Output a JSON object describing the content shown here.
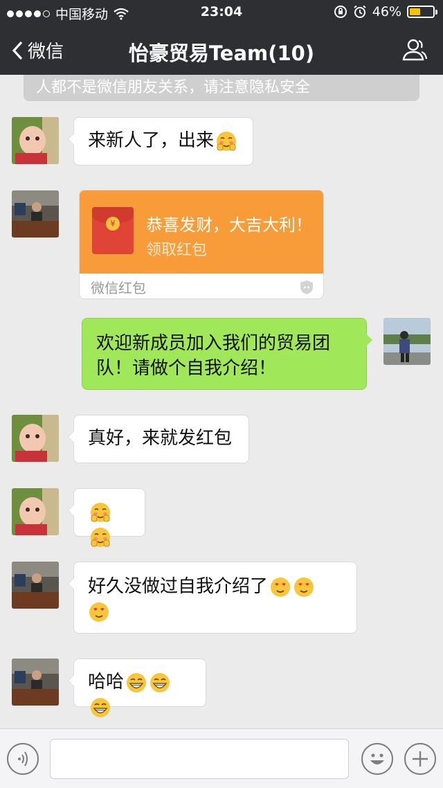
{
  "status": {
    "carrier": "中国移动",
    "time": "23:04",
    "battery": "46%",
    "battery_level": 0.46
  },
  "nav": {
    "back_label": "微信",
    "title": "怡豪贸易Team(10)"
  },
  "notice": "人都不是微信朋友关系，请注意隐私安全",
  "messages": [
    {
      "text": "来新人了，出来"
    },
    {
      "packet_title": "恭喜发财，大吉大利！",
      "packet_action": "领取红包",
      "packet_footer": "微信红包",
      "coin": "¥"
    },
    {
      "text_line1": "欢迎新成员加入我们的贸易团",
      "text_line2": "队！请做个自我介绍！"
    },
    {
      "text": "真好，来就发红包"
    },
    {
      "text": ""
    },
    {
      "text": "好久没做过自我介绍了"
    },
    {
      "text": "哈哈"
    }
  ],
  "colors": {
    "nav_bg": "#2e2f33",
    "chat_bg": "#ebebeb",
    "my_bubble": "#a0e759",
    "red_packet": "#f79c38"
  },
  "icons": [
    "chevron-left-icon",
    "contacts-icon",
    "voice-icon",
    "emoji-icon",
    "plus-icon",
    "wifi-icon",
    "lock-rotation-icon",
    "alarm-icon",
    "battery-icon",
    "shield-icon"
  ]
}
